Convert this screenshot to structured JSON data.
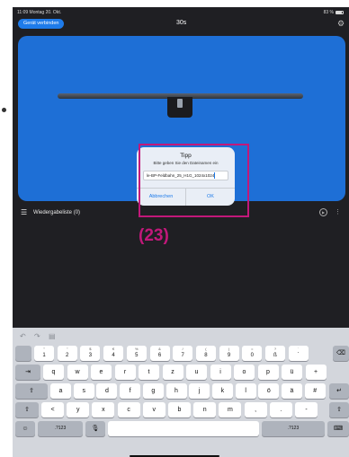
{
  "status_bar": {
    "time_date": "11:09  Montag 20. Okt.",
    "battery": "83 %"
  },
  "header": {
    "connect_button": "Gerät verbinden",
    "timer": "30s"
  },
  "dialog": {
    "title": "Tipp",
    "message": "Bitte geben Sie den Dateinamen ein",
    "input_value": "le-BP-Feldbahn_25_H1G_1024x1024",
    "cancel_label": "Abbrechen",
    "ok_label": "OK"
  },
  "annotation": {
    "label": "(23)",
    "color": "#c2187a"
  },
  "playlist": {
    "label": "Wiedergabeliste (0)"
  },
  "keyboard": {
    "row1": [
      {
        "top": "°",
        "bot": "1"
      },
      {
        "top": "\"",
        "bot": "2"
      },
      {
        "top": "$",
        "bot": "3"
      },
      {
        "top": "€",
        "bot": "4"
      },
      {
        "top": "%",
        "bot": "5"
      },
      {
        "top": "&",
        "bot": "6"
      },
      {
        "top": "/",
        "bot": "7"
      },
      {
        "top": "(",
        "bot": "8"
      },
      {
        "top": ")",
        "bot": "9"
      },
      {
        "top": "=",
        "bot": "0"
      },
      {
        "top": "?",
        "bot": "ß"
      },
      {
        "top": "`",
        "bot": "´"
      }
    ],
    "row2": [
      "q",
      "w",
      "e",
      "r",
      "t",
      "z",
      "u",
      "i",
      "o",
      "p",
      "ü",
      "+"
    ],
    "row3": [
      "a",
      "s",
      "d",
      "f",
      "g",
      "h",
      "j",
      "k",
      "l",
      "ö",
      "ä",
      "#"
    ],
    "row4": [
      "<",
      "y",
      "x",
      "c",
      "v",
      "b",
      "n",
      "m",
      ",",
      ".",
      "-"
    ],
    "numbers_label": ".?123",
    "numbers_label_right": ".?123"
  },
  "colors": {
    "accent": "#1e7bea",
    "preview_bg": "#1e6fd6",
    "app_bg": "#1f1f23"
  },
  "icons": [
    "undo-icon",
    "redo-icon",
    "paste-icon",
    "gear-icon",
    "playlist-icon",
    "play-icon",
    "more-icon",
    "delete-icon",
    "tab-icon",
    "return-icon",
    "shift-icon",
    "emoji-icon",
    "mic-icon",
    "keyboard-hide-icon"
  ]
}
